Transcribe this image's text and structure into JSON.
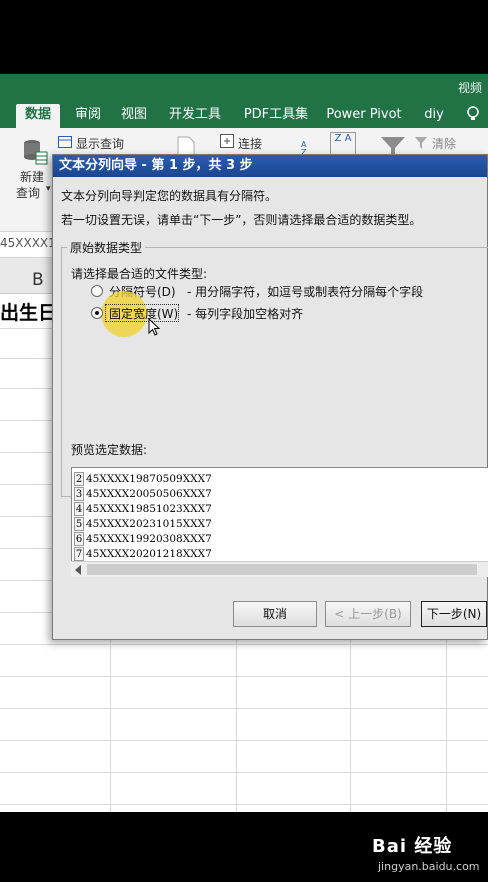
{
  "window": {
    "title_fragment": "视频"
  },
  "ribbon_tabs": [
    {
      "label": "数据",
      "active": true
    },
    {
      "label": "审阅",
      "active": false
    },
    {
      "label": "视图",
      "active": false
    },
    {
      "label": "开发工具",
      "active": false
    },
    {
      "label": "PDF工具集",
      "active": false
    },
    {
      "label": "Power Pivot",
      "active": false
    },
    {
      "label": "diy",
      "active": false
    }
  ],
  "ribbon": {
    "new_query_line1": "新建",
    "new_query_line2": "查询",
    "show_query": "显示查询",
    "connections": "连接",
    "sort_az": "Z A",
    "clear": "清除"
  },
  "formula_bar": {
    "name_box": "45XXXX1"
  },
  "sheet": {
    "column_b": "B",
    "cell_b1": "出生日"
  },
  "dialog": {
    "title": "文本分列向导 - 第 1 步，共 3 步",
    "line1": "文本分列向导判定您的数据具有分隔符。",
    "line2": "若一切设置无误，请单击“下一步”，否则请选择最合适的数据类型。",
    "group_title": "原始数据类型",
    "choose_label": "请选择最合适的文件类型:",
    "option_delimited": "分隔符号(D)",
    "option_delimited_desc": "- 用分隔字符，如逗号或制表符分隔每个字段",
    "option_fixed": "固定宽度(W)",
    "option_fixed_desc": "- 每列字段加空格对齐",
    "preview_label": "预览选定数据:",
    "preview_rows": [
      {
        "num": "2",
        "value": "45XXXX19870509XXX7"
      },
      {
        "num": "3",
        "value": "45XXXX20050506XXX7"
      },
      {
        "num": "4",
        "value": "45XXXX19851023XXX7"
      },
      {
        "num": "5",
        "value": "45XXXX20231015XXX7"
      },
      {
        "num": "6",
        "value": "45XXXX19920308XXX7"
      },
      {
        "num": "7",
        "value": "45XXXX20201218XXX7"
      }
    ],
    "btn_cancel": "取消",
    "btn_back": "< 上一步(B)",
    "btn_next": "下一步(N)"
  },
  "watermark": {
    "main": "Bai 经验",
    "sub": "jingyan.baidu.com"
  },
  "colors": {
    "excel_green": "#217346",
    "dialog_title": "#1b4590",
    "highlight": "#f0d228"
  }
}
